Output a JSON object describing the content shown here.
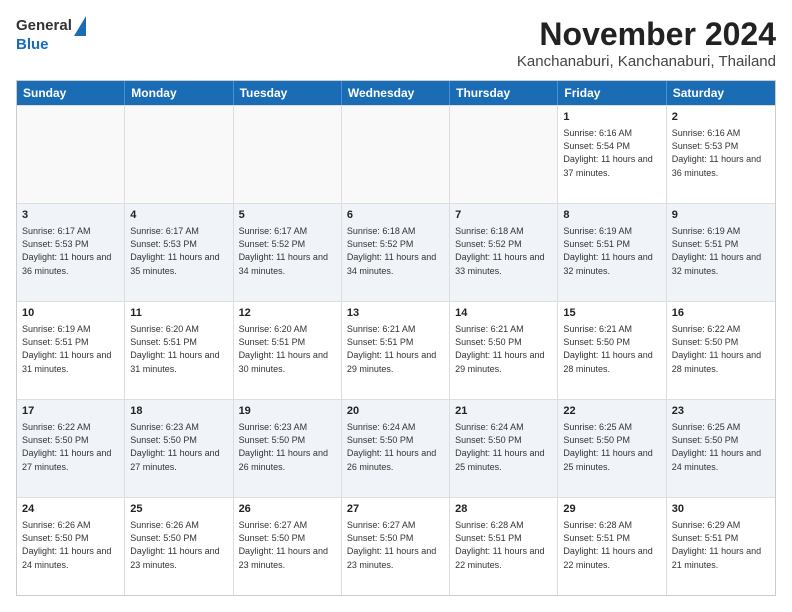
{
  "header": {
    "logo_general": "General",
    "logo_blue": "Blue",
    "title": "November 2024",
    "subtitle": "Kanchanaburi, Kanchanaburi, Thailand"
  },
  "calendar": {
    "days": [
      "Sunday",
      "Monday",
      "Tuesday",
      "Wednesday",
      "Thursday",
      "Friday",
      "Saturday"
    ],
    "rows": [
      [
        {
          "day": "",
          "empty": true
        },
        {
          "day": "",
          "empty": true
        },
        {
          "day": "",
          "empty": true
        },
        {
          "day": "",
          "empty": true
        },
        {
          "day": "",
          "empty": true
        },
        {
          "day": "1",
          "sunrise": "6:16 AM",
          "sunset": "5:54 PM",
          "daylight": "11 hours and 37 minutes."
        },
        {
          "day": "2",
          "sunrise": "6:16 AM",
          "sunset": "5:53 PM",
          "daylight": "11 hours and 36 minutes."
        }
      ],
      [
        {
          "day": "3",
          "sunrise": "6:17 AM",
          "sunset": "5:53 PM",
          "daylight": "11 hours and 36 minutes."
        },
        {
          "day": "4",
          "sunrise": "6:17 AM",
          "sunset": "5:53 PM",
          "daylight": "11 hours and 35 minutes."
        },
        {
          "day": "5",
          "sunrise": "6:17 AM",
          "sunset": "5:52 PM",
          "daylight": "11 hours and 34 minutes."
        },
        {
          "day": "6",
          "sunrise": "6:18 AM",
          "sunset": "5:52 PM",
          "daylight": "11 hours and 34 minutes."
        },
        {
          "day": "7",
          "sunrise": "6:18 AM",
          "sunset": "5:52 PM",
          "daylight": "11 hours and 33 minutes."
        },
        {
          "day": "8",
          "sunrise": "6:19 AM",
          "sunset": "5:51 PM",
          "daylight": "11 hours and 32 minutes."
        },
        {
          "day": "9",
          "sunrise": "6:19 AM",
          "sunset": "5:51 PM",
          "daylight": "11 hours and 32 minutes."
        }
      ],
      [
        {
          "day": "10",
          "sunrise": "6:19 AM",
          "sunset": "5:51 PM",
          "daylight": "11 hours and 31 minutes."
        },
        {
          "day": "11",
          "sunrise": "6:20 AM",
          "sunset": "5:51 PM",
          "daylight": "11 hours and 31 minutes."
        },
        {
          "day": "12",
          "sunrise": "6:20 AM",
          "sunset": "5:51 PM",
          "daylight": "11 hours and 30 minutes."
        },
        {
          "day": "13",
          "sunrise": "6:21 AM",
          "sunset": "5:51 PM",
          "daylight": "11 hours and 29 minutes."
        },
        {
          "day": "14",
          "sunrise": "6:21 AM",
          "sunset": "5:50 PM",
          "daylight": "11 hours and 29 minutes."
        },
        {
          "day": "15",
          "sunrise": "6:21 AM",
          "sunset": "5:50 PM",
          "daylight": "11 hours and 28 minutes."
        },
        {
          "day": "16",
          "sunrise": "6:22 AM",
          "sunset": "5:50 PM",
          "daylight": "11 hours and 28 minutes."
        }
      ],
      [
        {
          "day": "17",
          "sunrise": "6:22 AM",
          "sunset": "5:50 PM",
          "daylight": "11 hours and 27 minutes."
        },
        {
          "day": "18",
          "sunrise": "6:23 AM",
          "sunset": "5:50 PM",
          "daylight": "11 hours and 27 minutes."
        },
        {
          "day": "19",
          "sunrise": "6:23 AM",
          "sunset": "5:50 PM",
          "daylight": "11 hours and 26 minutes."
        },
        {
          "day": "20",
          "sunrise": "6:24 AM",
          "sunset": "5:50 PM",
          "daylight": "11 hours and 26 minutes."
        },
        {
          "day": "21",
          "sunrise": "6:24 AM",
          "sunset": "5:50 PM",
          "daylight": "11 hours and 25 minutes."
        },
        {
          "day": "22",
          "sunrise": "6:25 AM",
          "sunset": "5:50 PM",
          "daylight": "11 hours and 25 minutes."
        },
        {
          "day": "23",
          "sunrise": "6:25 AM",
          "sunset": "5:50 PM",
          "daylight": "11 hours and 24 minutes."
        }
      ],
      [
        {
          "day": "24",
          "sunrise": "6:26 AM",
          "sunset": "5:50 PM",
          "daylight": "11 hours and 24 minutes."
        },
        {
          "day": "25",
          "sunrise": "6:26 AM",
          "sunset": "5:50 PM",
          "daylight": "11 hours and 23 minutes."
        },
        {
          "day": "26",
          "sunrise": "6:27 AM",
          "sunset": "5:50 PM",
          "daylight": "11 hours and 23 minutes."
        },
        {
          "day": "27",
          "sunrise": "6:27 AM",
          "sunset": "5:50 PM",
          "daylight": "11 hours and 23 minutes."
        },
        {
          "day": "28",
          "sunrise": "6:28 AM",
          "sunset": "5:51 PM",
          "daylight": "11 hours and 22 minutes."
        },
        {
          "day": "29",
          "sunrise": "6:28 AM",
          "sunset": "5:51 PM",
          "daylight": "11 hours and 22 minutes."
        },
        {
          "day": "30",
          "sunrise": "6:29 AM",
          "sunset": "5:51 PM",
          "daylight": "11 hours and 21 minutes."
        }
      ]
    ]
  }
}
